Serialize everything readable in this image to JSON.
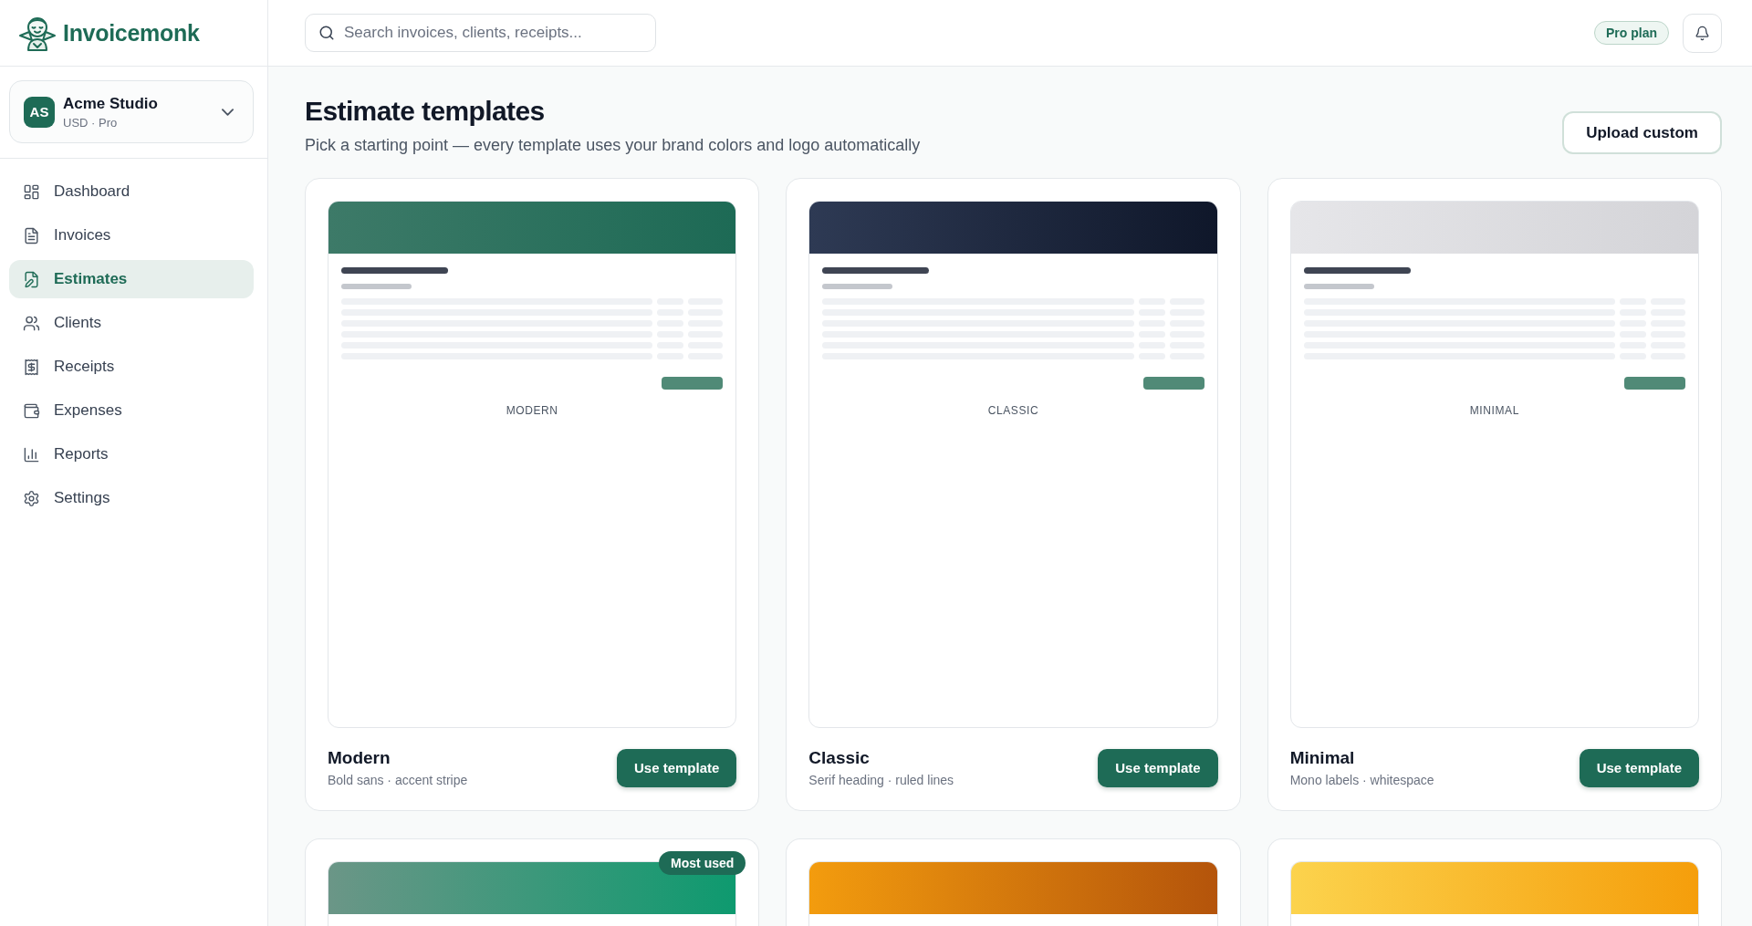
{
  "brand": {
    "name": "Invoicemonk"
  },
  "workspace": {
    "initials": "AS",
    "name": "Acme Studio",
    "details": "USD · Pro"
  },
  "nav": [
    {
      "label": "Dashboard",
      "selected": false
    },
    {
      "label": "Invoices",
      "selected": false
    },
    {
      "label": "Estimates",
      "selected": true
    },
    {
      "label": "Clients",
      "selected": false
    },
    {
      "label": "Receipts",
      "selected": false
    },
    {
      "label": "Expenses",
      "selected": false
    },
    {
      "label": "Reports",
      "selected": false
    },
    {
      "label": "Settings",
      "selected": false
    }
  ],
  "search": {
    "placeholder": "Search invoices, clients, receipts..."
  },
  "plan_badge": "Pro plan",
  "page": {
    "title": "Estimate templates",
    "subtitle": "Pick a starting point — every template uses your brand colors and logo automatically",
    "upload_button": "Upload custom"
  },
  "templates": [
    {
      "stripe": [
        {
          "color": "#3d7a68"
        },
        {
          "color": "#1d6a55"
        }
      ],
      "preview_label": "MODERN",
      "name": "Modern",
      "description": "Bold sans · accent stripe",
      "button": "Use template"
    },
    {
      "stripe": [
        {
          "color": "#2e3a54"
        },
        {
          "color": "#0f172a"
        }
      ],
      "preview_label": "CLASSIC",
      "name": "Classic",
      "description": "Serif heading · ruled lines",
      "button": "Use template"
    },
    {
      "stripe": [
        {
          "color": "#e6e6e9"
        },
        {
          "color": "#d4d4d8"
        }
      ],
      "preview_label": "MINIMAL",
      "name": "Minimal",
      "description": "Mono labels · whitespace",
      "button": "Use template"
    },
    {
      "stripe": [
        {
          "color": "#6b9687"
        },
        {
          "color": "#0e9a6f"
        }
      ],
      "badge": "Most used"
    },
    {
      "stripe": [
        {
          "color": "#f39c0e"
        },
        {
          "color": "#b4540b"
        }
      ]
    },
    {
      "stripe": [
        {
          "color": "#fcd34d"
        },
        {
          "color": "#f59e0b"
        }
      ]
    }
  ]
}
